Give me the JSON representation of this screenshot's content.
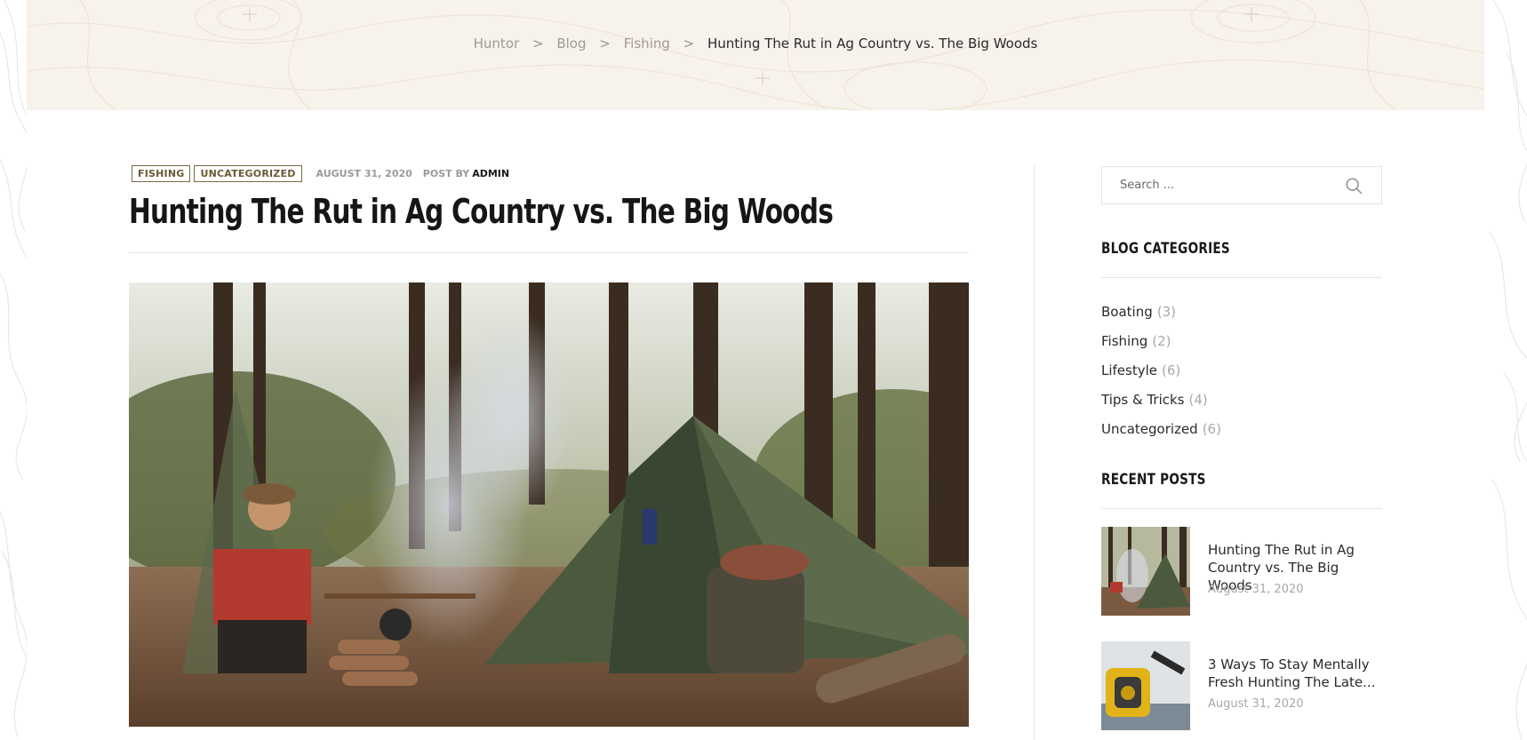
{
  "breadcrumb": {
    "items": [
      "Huntor",
      "Blog",
      "Fishing"
    ],
    "separator": ">",
    "current": "Hunting The Rut in Ag Country vs. The Big Woods"
  },
  "post": {
    "tags": [
      "FISHING",
      "UNCATEGORIZED"
    ],
    "date": "AUGUST 31, 2020",
    "by_label": "POST BY",
    "author": "ADMIN",
    "title": "Hunting The Rut in Ag Country vs. The Big Woods",
    "hero_image": "forest-camp-tent-photo"
  },
  "sidebar": {
    "search": {
      "placeholder": "Search ...",
      "value": ""
    },
    "categories_title": "BLOG CATEGORIES",
    "categories": [
      {
        "name": "Boating",
        "count": "(3)"
      },
      {
        "name": "Fishing",
        "count": "(2)"
      },
      {
        "name": "Lifestyle",
        "count": "(6)"
      },
      {
        "name": "Tips & Tricks",
        "count": "(4)"
      },
      {
        "name": "Uncategorized",
        "count": "(6)"
      }
    ],
    "recent_title": "RECENT POSTS",
    "recent_posts": [
      {
        "title": "Hunting The Rut in Ag Country vs. The Big Woods",
        "date": "August 31, 2020",
        "thumb": "forest-camp-thumb"
      },
      {
        "title": "3 Ways To Stay Mentally Fresh Hunting The Late...",
        "date": "August 31, 2020",
        "thumb": "fishing-reel-thumb"
      }
    ]
  },
  "colors": {
    "header_bg": "#f8f2ec",
    "tag_border": "#7a6a45",
    "muted_text": "#a8a8a8"
  }
}
